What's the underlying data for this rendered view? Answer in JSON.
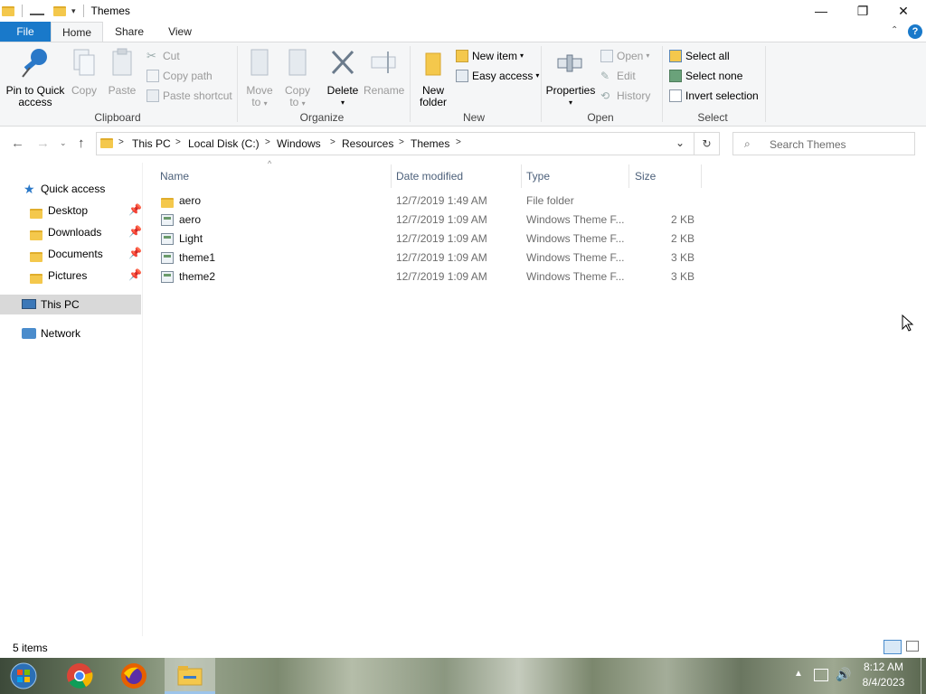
{
  "window": {
    "title": "Themes",
    "controls": {
      "minimize": "—",
      "restore": "❐",
      "close": "✕"
    }
  },
  "ribbon_tabs": [
    {
      "label": "File"
    },
    {
      "label": "Home"
    },
    {
      "label": "Share"
    },
    {
      "label": "View"
    }
  ],
  "help_icon": "?",
  "ribbon": {
    "clipboard": {
      "group_label": "Clipboard",
      "pin_line1": "Pin to Quick",
      "pin_line2": "access",
      "copy": "Copy",
      "paste": "Paste",
      "cut": "Cut",
      "copy_path": "Copy path",
      "paste_shortcut": "Paste shortcut"
    },
    "organize": {
      "group_label": "Organize",
      "move_line1": "Move",
      "move_line2": "to",
      "copy_line1": "Copy",
      "copy_line2": "to",
      "delete": "Delete",
      "rename": "Rename"
    },
    "new": {
      "group_label": "New",
      "folder_line1": "New",
      "folder_line2": "folder",
      "new_item": "New item",
      "easy_access": "Easy access"
    },
    "open": {
      "group_label": "Open",
      "properties": "Properties",
      "open": "Open",
      "edit": "Edit",
      "history": "History"
    },
    "select": {
      "group_label": "Select",
      "select_all": "Select all",
      "select_none": "Select none",
      "invert_selection": "Invert selection"
    }
  },
  "address": {
    "crumbs": [
      "This PC",
      "Local Disk (C:)",
      "Windows",
      "Resources",
      "Themes"
    ],
    "search_placeholder": "Search Themes"
  },
  "nav_pane": {
    "quick_access": "Quick access",
    "pinned": [
      "Desktop",
      "Downloads",
      "Documents",
      "Pictures"
    ],
    "this_pc": "This PC",
    "network": "Network"
  },
  "columns": {
    "name": "Name",
    "date": "Date modified",
    "type": "Type",
    "size": "Size"
  },
  "files": [
    {
      "name": "aero",
      "date": "12/7/2019 1:49 AM",
      "type": "File folder",
      "size": "",
      "kind": "folder"
    },
    {
      "name": "aero",
      "date": "12/7/2019 1:09 AM",
      "type": "Windows Theme F...",
      "size": "2 KB",
      "kind": "theme"
    },
    {
      "name": "Light",
      "date": "12/7/2019 1:09 AM",
      "type": "Windows Theme F...",
      "size": "2 KB",
      "kind": "theme"
    },
    {
      "name": "theme1",
      "date": "12/7/2019 1:09 AM",
      "type": "Windows Theme F...",
      "size": "3 KB",
      "kind": "theme"
    },
    {
      "name": "theme2",
      "date": "12/7/2019 1:09 AM",
      "type": "Windows Theme F...",
      "size": "3 KB",
      "kind": "theme"
    }
  ],
  "status": {
    "item_count": "5 items"
  },
  "taskbar": {
    "time": "8:12 AM",
    "date": "8/4/2023"
  },
  "colors": {
    "accent": "#1979ca",
    "selected_nav": "#d9d9d9",
    "column_header": "#4c607a"
  }
}
